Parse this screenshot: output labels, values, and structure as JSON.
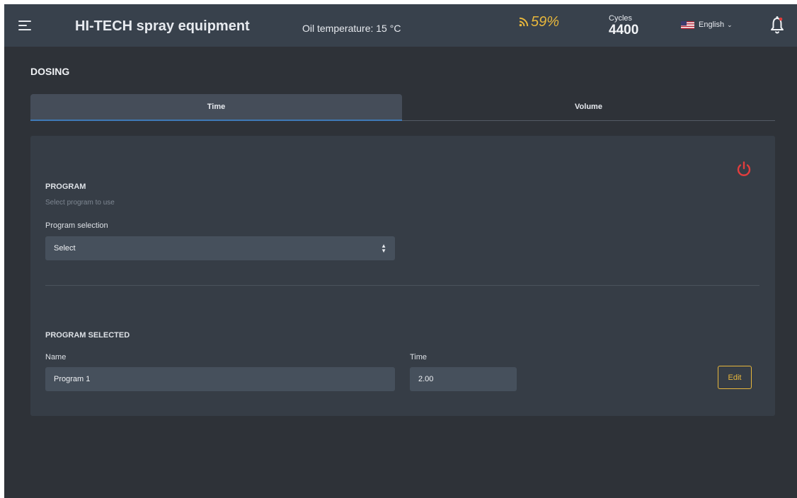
{
  "header": {
    "brand": "HI-TECH spray equipment",
    "oil_temperature": "Oil temperature: 15 °C",
    "signal_strength": "59%",
    "cycles_label": "Cycles",
    "cycles_value": "4400",
    "language": "English",
    "icons": {
      "menu": "hamburger-icon",
      "signal": "rss-signal-icon",
      "flag": "us-flag-icon",
      "language_caret": "chevron-down-icon",
      "notifications": "bell-icon"
    }
  },
  "page": {
    "title": "DOSING",
    "tabs": [
      {
        "label": "Time",
        "active": true
      },
      {
        "label": "Volume",
        "active": false
      }
    ]
  },
  "program": {
    "section_title": "PROGRAM",
    "hint": "Select program to use",
    "selection_label": "Program selection",
    "selection_value": "Select",
    "power_icon": "power-icon"
  },
  "program_selected": {
    "section_title": "PROGRAM SELECTED",
    "name_label": "Name",
    "name_value": "Program 1",
    "time_label": "Time",
    "time_value": "2.00",
    "edit_label": "Edit"
  },
  "colors": {
    "background": "#2e3238",
    "header": "#38414c",
    "card": "#363d46",
    "input": "#46505c",
    "accent_gold": "#e8b73c",
    "accent_red": "#e23d3d",
    "tab_underline": "#3f79b6"
  }
}
